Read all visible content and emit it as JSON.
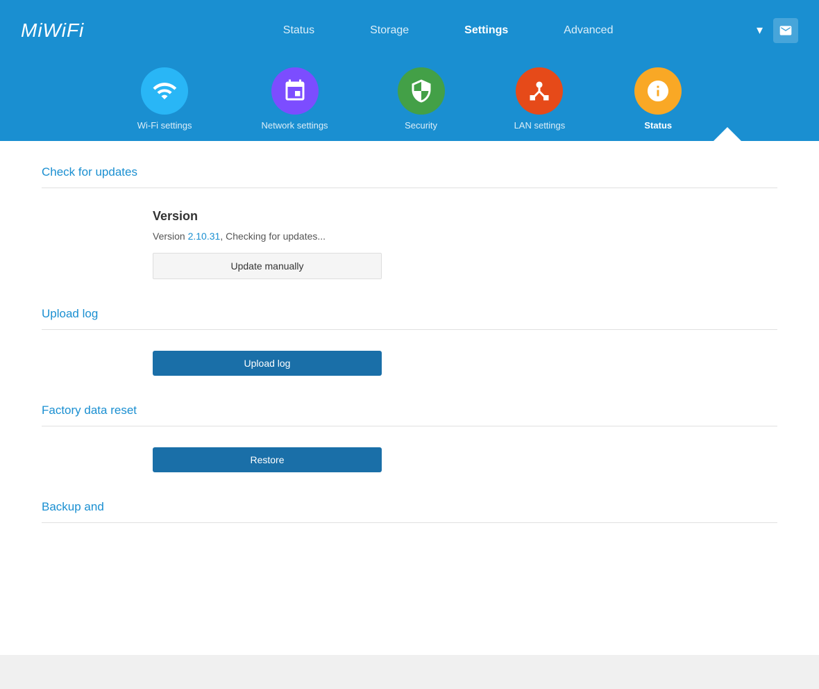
{
  "logo": {
    "text": "MiWiFi"
  },
  "nav": {
    "links": [
      {
        "label": "Status",
        "id": "status",
        "active": false
      },
      {
        "label": "Storage",
        "id": "storage",
        "active": false
      },
      {
        "label": "Settings",
        "id": "settings",
        "active": true
      },
      {
        "label": "Advanced",
        "id": "advanced",
        "active": false
      }
    ]
  },
  "subnav": {
    "items": [
      {
        "label": "Wi-Fi settings",
        "id": "wifi",
        "active": false,
        "iconClass": "icon-wifi"
      },
      {
        "label": "Network settings",
        "id": "network",
        "active": false,
        "iconClass": "icon-network"
      },
      {
        "label": "Security",
        "id": "security",
        "active": false,
        "iconClass": "icon-security"
      },
      {
        "label": "LAN settings",
        "id": "lan",
        "active": false,
        "iconClass": "icon-lan"
      },
      {
        "label": "Status",
        "id": "status-icon",
        "active": true,
        "iconClass": "icon-status"
      }
    ]
  },
  "sections": {
    "check_for_updates": {
      "title": "Check for updates",
      "version_label": "Version",
      "version_text_prefix": "Version ",
      "version_number": "2.10.31",
      "version_text_suffix": ", Checking for updates...",
      "update_button_label": "Update manually"
    },
    "upload_log": {
      "title": "Upload log",
      "button_label": "Upload log"
    },
    "factory_reset": {
      "title": "Factory data reset",
      "button_label": "Restore"
    },
    "backup": {
      "title": "Backup and"
    }
  }
}
